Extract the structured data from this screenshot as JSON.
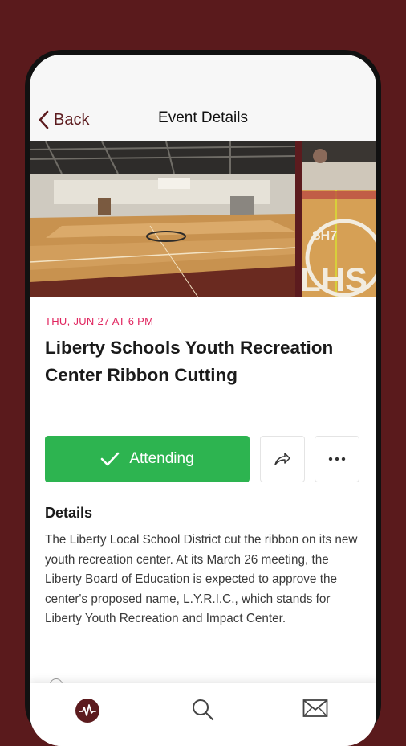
{
  "header": {
    "back_label": "Back",
    "title": "Event Details"
  },
  "hero": {
    "logo_text_top": "SH7",
    "logo_text_bottom": "LHS"
  },
  "event": {
    "date": "THU, JUN 27 AT 6 PM",
    "title": "Liberty Schools Youth Recreation Center Ribbon Cutting"
  },
  "actions": {
    "attending_label": "Attending"
  },
  "details": {
    "heading": "Details",
    "body": "The Liberty Local School District cut the ribbon on its new youth recreation center.  At its March 26 meeting, the Liberty Board of Education is expected to approve the center's proposed name, L.Y.R.I.C., which stands for Liberty Youth Recreation and Impact Center."
  },
  "colors": {
    "background": "#5a1a1c",
    "accent": "#5c1b1e",
    "attending_green": "#2db450",
    "date_pink": "#e0245e"
  },
  "tabbar": {
    "icons": [
      "activity-icon",
      "search-icon",
      "mail-icon"
    ]
  }
}
